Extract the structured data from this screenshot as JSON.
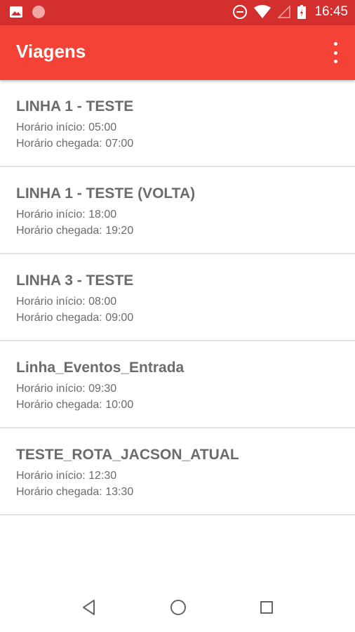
{
  "status_bar": {
    "time": "16:45",
    "icons": [
      "image-icon",
      "circle-notification-icon",
      "do-not-disturb-icon",
      "wifi-icon",
      "signal-icon",
      "battery-icon"
    ]
  },
  "app_bar": {
    "title": "Viagens",
    "menu_icon": "overflow-menu-icon"
  },
  "trips": [
    {
      "name": "LINHA 1 - TESTE",
      "inicio": "Horário início: 05:00",
      "chegada": "Horário chegada: 07:00"
    },
    {
      "name": "LINHA 1 - TESTE (VOLTA)",
      "inicio": "Horário início: 18:00",
      "chegada": "Horário chegada: 19:20"
    },
    {
      "name": "LINHA 3 - TESTE",
      "inicio": "Horário início: 08:00",
      "chegada": "Horário chegada: 09:00"
    },
    {
      "name": "Linha_Eventos_Entrada",
      "inicio": "Horário início: 09:30",
      "chegada": "Horário chegada: 10:00"
    },
    {
      "name": "TESTE_ROTA_JACSON_ATUAL",
      "inicio": "Horário início: 12:30",
      "chegada": "Horário chegada: 13:30"
    }
  ],
  "nav_bar": {
    "icons": [
      "back-icon",
      "home-icon",
      "recents-icon"
    ]
  },
  "colors": {
    "status_bar": "#d32f2f",
    "app_bar": "#f44336",
    "text": "#6b6b6b"
  }
}
